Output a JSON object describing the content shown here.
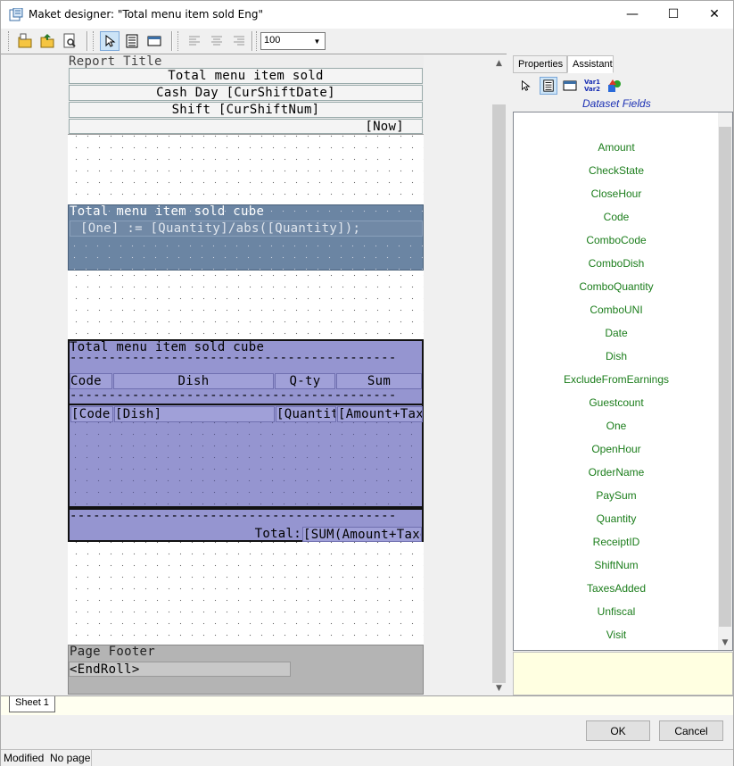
{
  "window": {
    "title": "Maket designer: \"Total menu item sold Eng\"",
    "minimize": "—",
    "maximize": "☐",
    "close": "✕"
  },
  "toolbar": {
    "zoom_value": "100"
  },
  "report": {
    "title_band": "Report Title",
    "title_line1": "Total menu item sold",
    "title_line2": "Cash Day [CurShiftDate]",
    "title_line3": "Shift [CurShiftNum]",
    "title_now": "[Now]",
    "cube1_title": "Total menu item sold cube",
    "cube1_expr": "[One] := [Quantity]/abs([Quantity]);",
    "cube2_title": "Total menu item sold cube",
    "cube2_dashes": "------------------------------------------",
    "headers": [
      "Code",
      "Dish",
      "Q-ty",
      "Sum"
    ],
    "data_fields": [
      "[Code]",
      "[Dish]",
      "[Quantity]",
      "[Amount+TaxesAdded]"
    ],
    "total_label": "Total:",
    "total_value": "[SUM(Amount+TaxesAdded)]",
    "page_footer": "Page Footer",
    "endroll": "<EndRoll>"
  },
  "panel": {
    "tab_properties": "Properties",
    "tab_assistant": "Assistant",
    "var1": "Var1",
    "var2": "Var2",
    "dataset_title": "Dataset Fields",
    "fields": [
      "Amount",
      "CheckState",
      "CloseHour",
      "Code",
      "ComboCode",
      "ComboDish",
      "ComboQuantity",
      "ComboUNI",
      "Date",
      "Dish",
      "ExcludeFromEarnings",
      "Guestcount",
      "One",
      "OpenHour",
      "OrderName",
      "PaySum",
      "Quantity",
      "ReceiptID",
      "ShiftNum",
      "TaxesAdded",
      "Unfiscal",
      "Visit"
    ]
  },
  "sheet_tab": "Sheet 1",
  "buttons": {
    "ok": "OK",
    "cancel": "Cancel"
  },
  "status": {
    "modified": "Modified",
    "page": "No page"
  },
  "colors": {
    "cube1_band": "#6b85a3",
    "cube2_band": "#9595d0",
    "field_green": "#1b7d1b",
    "dataset_title": "#1a2fb3"
  }
}
